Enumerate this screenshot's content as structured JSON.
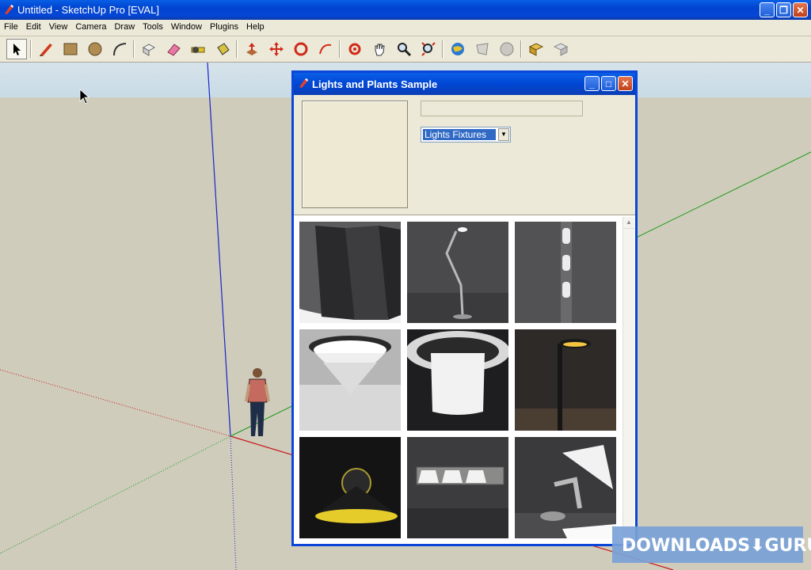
{
  "window": {
    "title": "Untitled - SketchUp Pro [EVAL]",
    "min": "_",
    "max": "❐",
    "close": "✕"
  },
  "menu": [
    "File",
    "Edit",
    "View",
    "Camera",
    "Draw",
    "Tools",
    "Window",
    "Plugins",
    "Help"
  ],
  "toolbar": [
    "select-icon",
    "pencil-icon",
    "rectangle-icon",
    "circle-icon",
    "arc-icon",
    "make-component-icon",
    "eraser-icon",
    "tape-measure-icon",
    "paint-bucket-icon",
    "push-pull-icon",
    "move-icon",
    "rotate-icon",
    "follow-me-icon",
    "orbit-icon",
    "pan-icon",
    "zoom-icon",
    "zoom-extents-icon",
    "get-models-icon",
    "share-model-icon",
    "google-earth-icon",
    "components-icon",
    "3d-warehouse-icon"
  ],
  "dialog": {
    "title": "Lights and Plants Sample",
    "name_value": "",
    "collection_selected": "Lights Fixtures",
    "min": "_",
    "max": "□",
    "close": "✕"
  },
  "thumbnails": [
    "spotlight-fixture",
    "floor-lamp",
    "wall-sconce-lights",
    "ceiling-light-round",
    "pendant-light-drum",
    "street-lamp",
    "hanging-lamp-shade",
    "vanity-light-bar",
    "desk-lamp"
  ],
  "watermark": "DOWNLOADS⬇GURU",
  "colors": {
    "titlebar": "#0a46d8",
    "axis_blue": "#1a24c8",
    "axis_red": "#c81a1a",
    "axis_green": "#1a9a1a"
  }
}
